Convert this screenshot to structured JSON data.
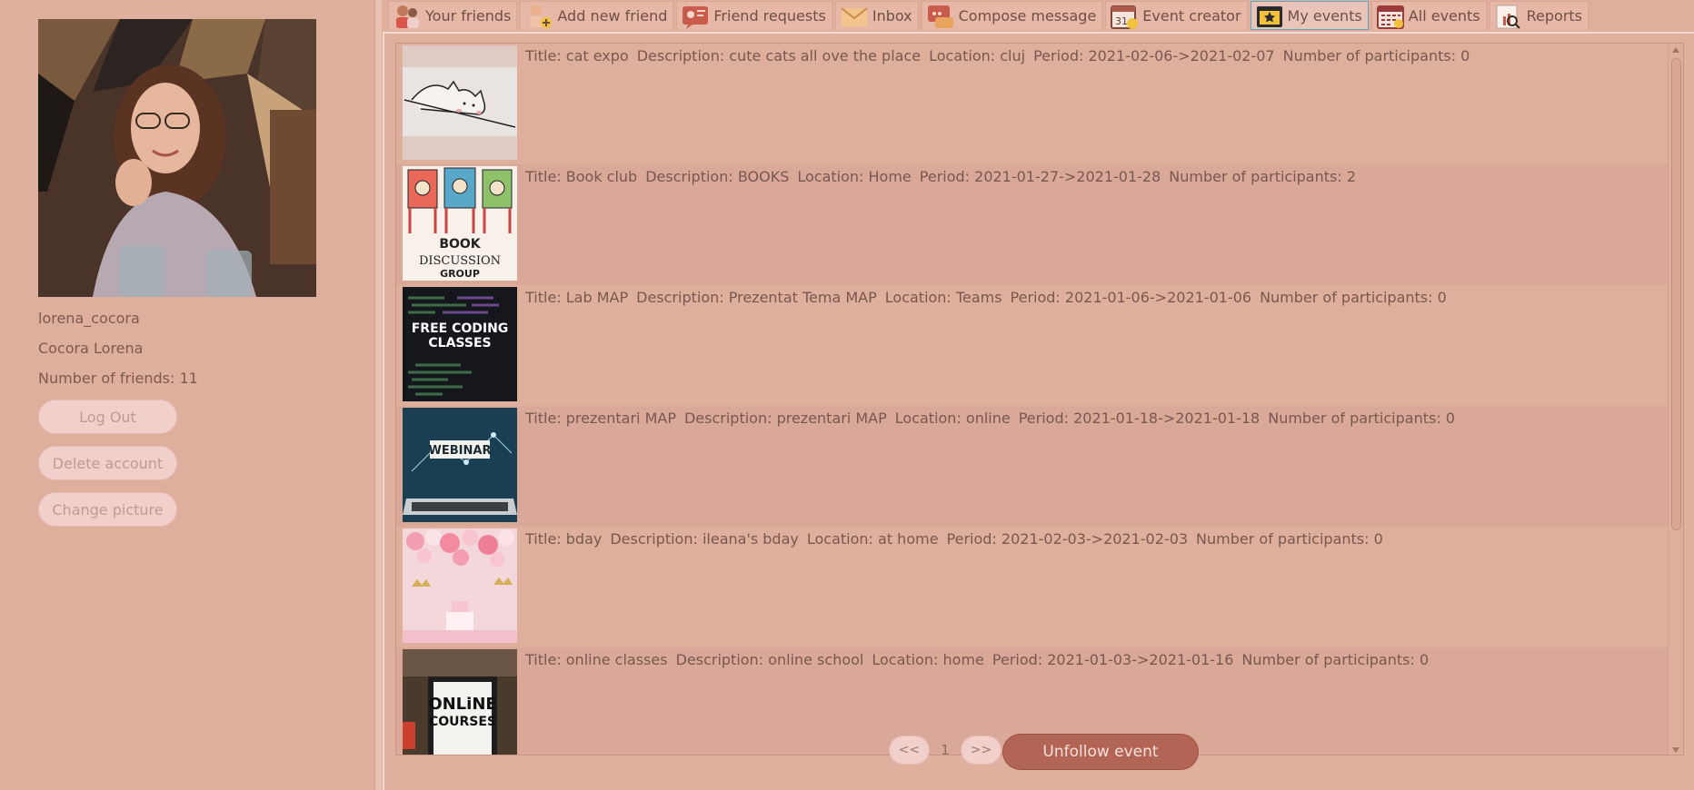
{
  "profile": {
    "username": "lorena_cocora",
    "full_name": "Cocora Lorena",
    "friends_count": "Number of friends: 11"
  },
  "sidebar_buttons": {
    "logout": "Log Out",
    "delete": "Delete account",
    "change_picture": "Change picture"
  },
  "tabs": [
    {
      "label": "Your friends",
      "icon": "friends-icon"
    },
    {
      "label": "Add new friend",
      "icon": "add-friend-icon"
    },
    {
      "label": "Friend requests",
      "icon": "friend-requests-icon"
    },
    {
      "label": "Inbox",
      "icon": "inbox-icon"
    },
    {
      "label": "Compose message",
      "icon": "compose-icon"
    },
    {
      "label": "Event creator",
      "icon": "event-creator-icon"
    },
    {
      "label": "My events",
      "icon": "my-events-icon",
      "active": true
    },
    {
      "label": "All events",
      "icon": "all-events-icon"
    },
    {
      "label": "Reports",
      "icon": "reports-icon"
    }
  ],
  "events": [
    {
      "title": "Title: cat expo",
      "description": "Description: cute cats all ove the place",
      "location": "Location: cluj",
      "period": "Period: 2021-02-06->2021-02-07",
      "participants": "Number of participants: 0",
      "thumb": "cat-drawing"
    },
    {
      "title": "Title: Book club",
      "description": "Description: BOOKS",
      "location": "Location: Home",
      "period": "Period: 2021-01-27->2021-01-28",
      "participants": "Number of participants: 2",
      "thumb": "book-discussion",
      "thumb_text_1": "BOOK",
      "thumb_text_2": "DISCUSSION",
      "thumb_text_3": "GROUP"
    },
    {
      "title": "Title: Lab MAP",
      "description": "Description: Prezentat Tema MAP",
      "location": "Location: Teams",
      "period": "Period: 2021-01-06->2021-01-06",
      "participants": "Number of participants: 0",
      "thumb": "free-coding",
      "thumb_text_1": "FREE CODING",
      "thumb_text_2": "CLASSES"
    },
    {
      "title": "Title: prezentari MAP",
      "description": "Description: prezentari MAP",
      "location": "Location: online",
      "period": "Period: 2021-01-18->2021-01-18",
      "participants": "Number of participants: 0",
      "thumb": "webinar-laptop",
      "thumb_text_1": "WEBINAR"
    },
    {
      "title": "Title: bday",
      "description": "Description: ileana's bday",
      "location": "Location: at home",
      "period": "Period: 2021-02-03->2021-02-03",
      "participants": "Number of participants: 0",
      "thumb": "birthday-balloons"
    },
    {
      "title": "Title: online classes",
      "description": "Description: online school",
      "location": "Location: home",
      "period": "Period: 2021-01-03->2021-01-16",
      "participants": "Number of participants: 0",
      "thumb": "online-courses",
      "thumb_text_1": "ONLiNE",
      "thumb_text_2": "COURSES"
    }
  ],
  "pagination": {
    "prev": "<<",
    "page": "1",
    "next": ">>"
  },
  "actions": {
    "unfollow": "Unfollow event"
  },
  "colors": {
    "background": "#dfaf9d",
    "accent": "#b26554",
    "active_tab_border": "#5ea6c8"
  }
}
